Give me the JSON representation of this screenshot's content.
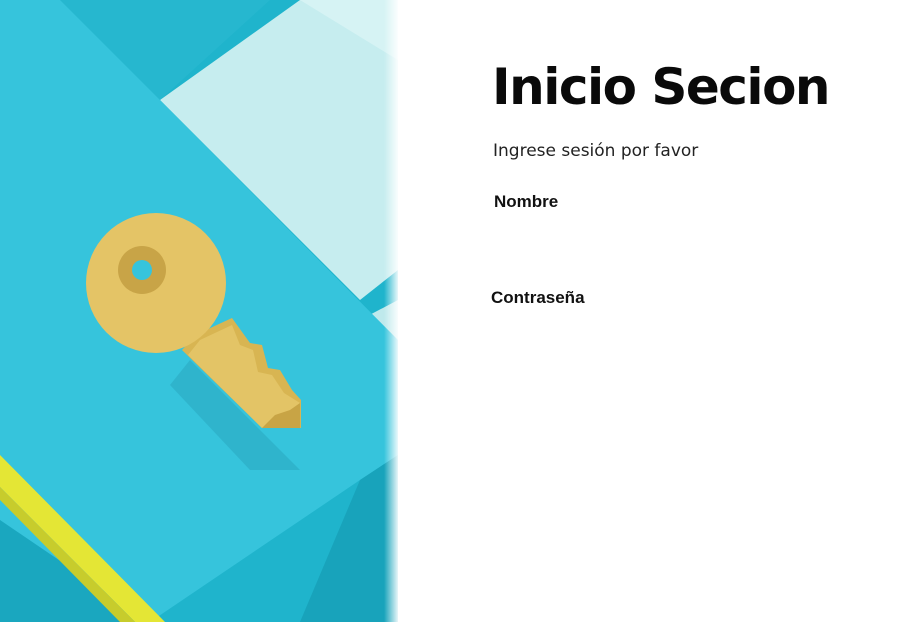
{
  "login": {
    "title": "Inicio Secion",
    "subtitle": "Ingrese sesión por favor",
    "fields": {
      "name_label": "Nombre",
      "name_value": "",
      "password_label": "Contraseña",
      "password_value": ""
    }
  },
  "illustration": {
    "icon": "key-icon",
    "colors": {
      "paper_dark": "#1fb4cc",
      "paper_main": "#34c3dc",
      "paper_light": "#c8eef0",
      "key": "#e4c363",
      "key_shadow": "#c4a24a",
      "accent_yellow": "#e6e83a"
    }
  }
}
